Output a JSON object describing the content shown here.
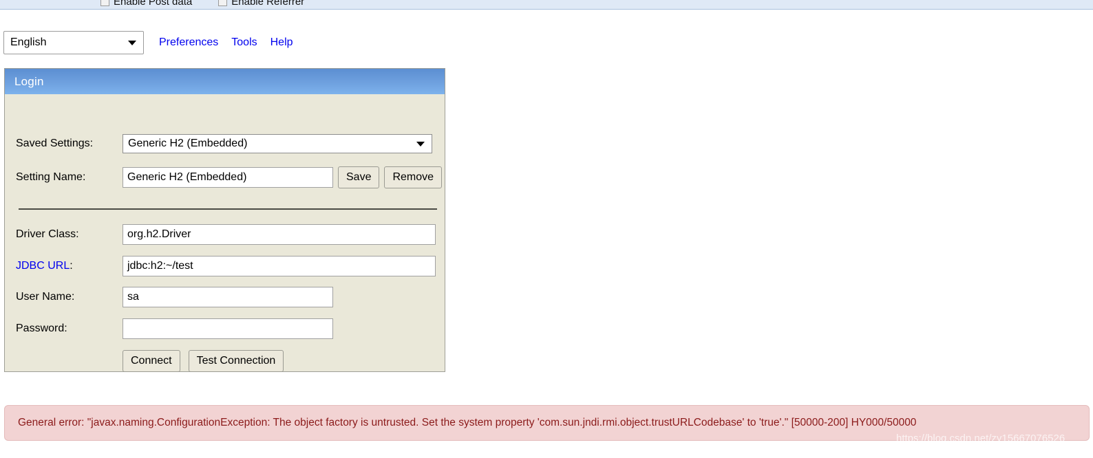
{
  "toolbar": {
    "checkbox_post_data_label": "Enable Post data",
    "checkbox_referrer_label": "Enable Referrer"
  },
  "nav": {
    "language_selected": "English",
    "links": [
      {
        "label": "Preferences"
      },
      {
        "label": "Tools"
      },
      {
        "label": "Help"
      }
    ]
  },
  "panel": {
    "title": "Login",
    "fields": {
      "saved_settings_label": "Saved Settings:",
      "saved_settings_value": "Generic H2 (Embedded)",
      "setting_name_label": "Setting Name:",
      "setting_name_value": "Generic H2 (Embedded)",
      "driver_class_label": "Driver Class:",
      "driver_class_value": "org.h2.Driver",
      "jdbc_url_label_link": "JDBC URL",
      "jdbc_url_label_colon": ":",
      "jdbc_url_value": "jdbc:h2:~/test",
      "user_name_label": "User Name:",
      "user_name_value": "sa",
      "password_label": "Password:",
      "password_value": ""
    },
    "buttons": {
      "save": "Save",
      "remove": "Remove",
      "connect": "Connect",
      "test_connection": "Test Connection"
    }
  },
  "error": {
    "message": "General error: \"javax.naming.ConfigurationException: The object factory is untrusted. Set the system property 'com.sun.jndi.rmi.object.trustURLCodebase' to 'true'.\" [50000-200] HY000/50000"
  },
  "watermark": {
    "text": "https://blog.csdn.net/zy15667076526"
  },
  "colors": {
    "panel_header_top": "#5c8fd2",
    "panel_header_bottom": "#7db2ec",
    "panel_body": "#eae8d9",
    "link": "#0000ee",
    "error_bg": "#f2d3d3",
    "error_text": "#8b1a1a",
    "toolbar_strip": "#dfe9f6"
  }
}
